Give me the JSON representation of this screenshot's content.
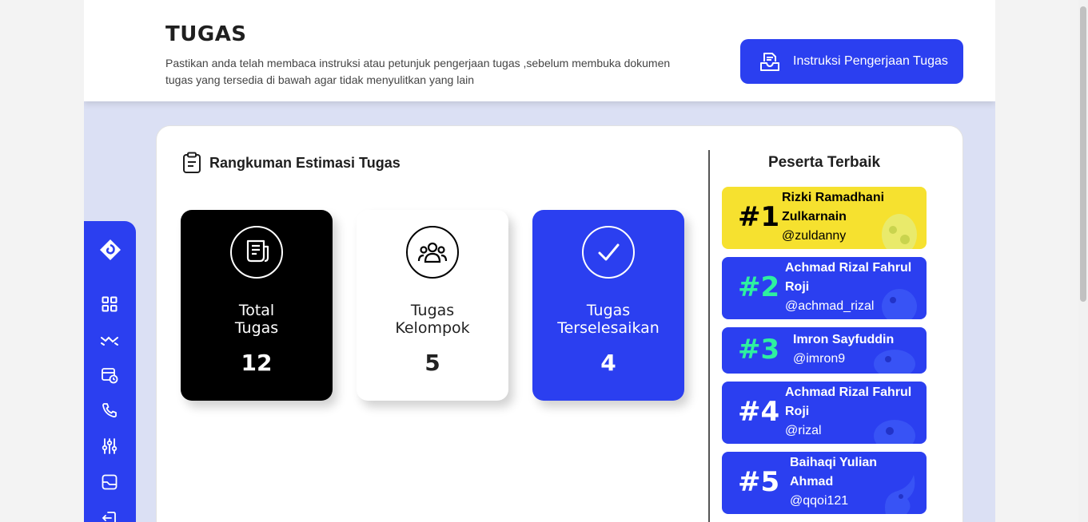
{
  "header": {
    "title": "TUGAS",
    "description": "Pastikan anda telah membaca instruksi atau petunjuk pengerjaan tugas ,sebelum membuka dokumen tugas yang tersedia di bawah agar tidak menyulitkan yang lain",
    "instruction_button": "Instruksi Pengerjaan Tugas"
  },
  "sidebar": {
    "items": [
      {
        "icon": "logo-icon"
      },
      {
        "icon": "grid-icon"
      },
      {
        "icon": "trend-icon"
      },
      {
        "icon": "calendar-clock-icon"
      },
      {
        "icon": "phone-icon"
      },
      {
        "icon": "sliders-icon"
      },
      {
        "icon": "chart-icon"
      },
      {
        "icon": "logout-icon"
      }
    ]
  },
  "summary": {
    "title": "Rangkuman Estimasi Tugas",
    "stats": [
      {
        "label_line1": "Total",
        "label_line2": "Tugas",
        "value": "12",
        "bg": "#000000",
        "fg": "#ffffff",
        "icon": "receipt-icon"
      },
      {
        "label_line1": "Tugas",
        "label_line2": "Kelompok",
        "value": "5",
        "bg": "#ffffff",
        "fg": "#222222",
        "icon": "group-icon"
      },
      {
        "label_line1": "Tugas",
        "label_line2": "Terselesaikan",
        "value": "4",
        "bg": "#2b3ff0",
        "fg": "#ffffff",
        "icon": "check-icon"
      }
    ]
  },
  "best": {
    "title": "Peserta Terbaik",
    "participants": [
      {
        "rank": "#1",
        "name_line1": "Rizki Ramadhani",
        "name_line2": "Zulkarnain",
        "username": "@zuldanny",
        "bg": "#f6e12f",
        "rank_color": "#000000",
        "text_color": "#000000"
      },
      {
        "rank": "#2",
        "name_line1": "Achmad Rizal Fahrul",
        "name_line2": "Roji",
        "username": "@achmad_rizal",
        "bg": "#2b3ff0",
        "rank_color": "#2ef0a0",
        "text_color": "#ffffff"
      },
      {
        "rank": "#3",
        "name_line1": "Imron Sayfuddin",
        "name_line2": "",
        "username": "@imron9",
        "bg": "#2b3ff0",
        "rank_color": "#2ef0a0",
        "text_color": "#ffffff"
      },
      {
        "rank": "#4",
        "name_line1": "Achmad Rizal Fahrul",
        "name_line2": "Roji",
        "username": "@rizal",
        "bg": "#2b3ff0",
        "rank_color": "#ffffff",
        "text_color": "#ffffff"
      },
      {
        "rank": "#5",
        "name_line1": "Baihaqi Yulian",
        "name_line2": "Ahmad",
        "username": "@qqoi121",
        "bg": "#2b3ff0",
        "rank_color": "#ffffff",
        "text_color": "#ffffff"
      }
    ]
  },
  "colors": {
    "accent": "#2b3ff0",
    "background": "#dbe0f4"
  }
}
